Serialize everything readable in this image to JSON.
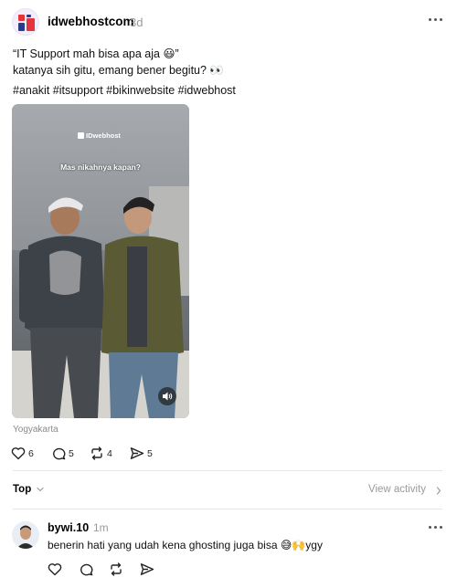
{
  "post": {
    "username": "idwebhostcom",
    "time_ago": "3d",
    "caption_line1": "“IT Support mah bisa apa aja 😃”",
    "caption_line2": "katanya sih gitu, emang bener begitu? 👀",
    "hashtags": "#anakit #itsupport #bikinwebsite #idwebhost",
    "media": {
      "watermark": "IDwebhost",
      "overlay_text": "Mas nikahnya kapan?"
    },
    "location": "Yogyakarta",
    "counts": {
      "likes": "6",
      "replies": "5",
      "reposts": "4",
      "shares": "5"
    }
  },
  "sort": {
    "label": "Top",
    "view_activity": "View activity"
  },
  "reply": {
    "username": "bywi.10",
    "time_ago": "1m",
    "text": "benerin hati yang udah kena ghosting juga bisa 😅🙌ygy"
  },
  "colors": {
    "brand_red": "#e4343c",
    "brand_blue": "#2a3a8c",
    "muted_text": "#9a9a9a"
  },
  "icons": [
    "heart-icon",
    "comment-icon",
    "repost-icon",
    "share-icon",
    "more-icon",
    "chevron-down-icon",
    "chevron-right-icon",
    "volume-icon"
  ]
}
